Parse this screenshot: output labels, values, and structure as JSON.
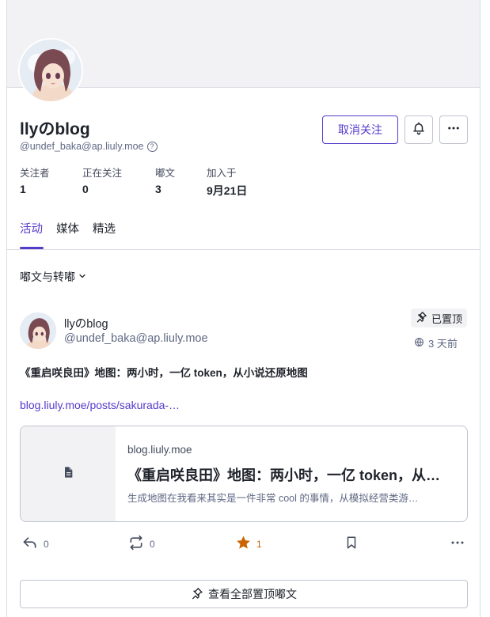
{
  "profile": {
    "display_name": "llyのblog",
    "handle": "@undef_baka@ap.liuly.moe",
    "handle_help": "?",
    "unfollow_label": "取消关注",
    "bell_icon": "bell-icon",
    "more_icon": "ellipsis-icon"
  },
  "stats": [
    {
      "label": "关注者",
      "value": "1"
    },
    {
      "label": "正在关注",
      "value": "0"
    },
    {
      "label": "嘟文",
      "value": "3"
    },
    {
      "label": "加入于",
      "value": "9月21日"
    }
  ],
  "tabs": [
    {
      "label": "活动",
      "active": true
    },
    {
      "label": "媒体",
      "active": false
    },
    {
      "label": "精选",
      "active": false
    }
  ],
  "filter": {
    "label": "嘟文与转嘟",
    "icon": "chevron-down-icon"
  },
  "post": {
    "author_name": "llyのblog",
    "author_handle": "@undef_baka@ap.liuly.moe",
    "pinned_label": "已置顶",
    "time_ago": "3 天前",
    "text": "《重启咲良田》地图：两小时，一亿 token，从小说还原地图",
    "link": "blog.liuly.moe/posts/sakurada-…",
    "card": {
      "site": "blog.liuly.moe",
      "title": "《重启咲良田》地图：两小时，一亿 token，从…",
      "description": "生成地图在我看来其实是一件非常 cool 的事情，从模拟经营类游…"
    },
    "actions": {
      "reply_count": "0",
      "boost_count": "0",
      "fav_count": "1"
    }
  },
  "all_pinned_label": "查看全部置顶嘟文",
  "colors": {
    "accent": "#563acc",
    "favorite": "#ca6300",
    "muted": "#606984"
  }
}
